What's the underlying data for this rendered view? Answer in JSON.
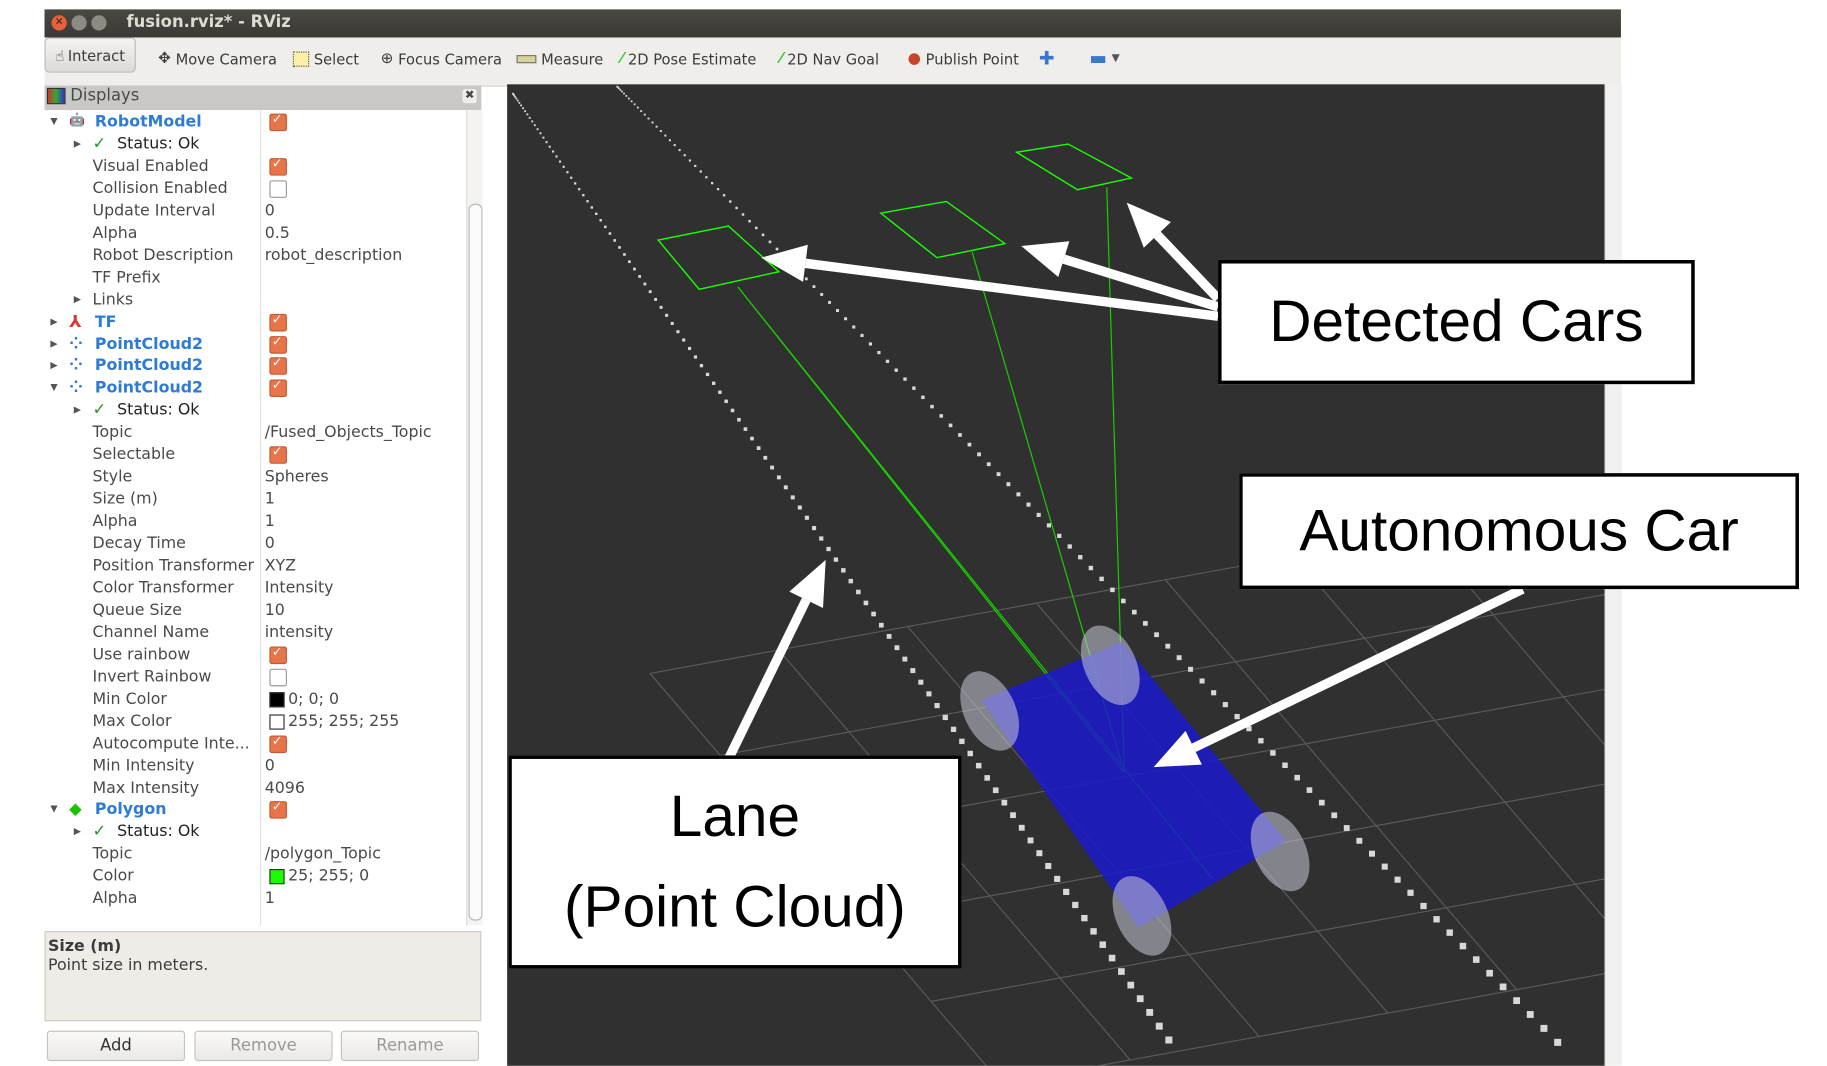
{
  "window": {
    "title": "fusion.rviz* - RViz"
  },
  "toolbar": {
    "items": [
      {
        "icon": "hand-pointer-icon",
        "label": "Interact",
        "pressed": true
      },
      {
        "icon": "move-camera-icon",
        "label": "Move Camera"
      },
      {
        "icon": "select-box-icon",
        "label": "Select"
      },
      {
        "icon": "focus-camera-icon",
        "label": "Focus Camera"
      },
      {
        "icon": "ruler-icon",
        "label": "Measure"
      },
      {
        "icon": "green-arrow-icon",
        "label": "2D Pose Estimate"
      },
      {
        "icon": "green-arrow-icon",
        "label": "2D Nav Goal"
      },
      {
        "icon": "map-pin-icon",
        "label": "Publish Point"
      }
    ],
    "add_tool_icon": "plus-icon",
    "remove_tool_icon": "minus-icon"
  },
  "displays": {
    "title": "Displays",
    "rows": [
      {
        "lvl": 0,
        "exp": "down",
        "icon": "robot",
        "label": "RobotModel",
        "check": true
      },
      {
        "lvl": 1,
        "exp": "right",
        "icon": "ok",
        "label": "Status: Ok"
      },
      {
        "lvl": 1,
        "label": "Visual Enabled",
        "check": true
      },
      {
        "lvl": 1,
        "label": "Collision Enabled",
        "check": false
      },
      {
        "lvl": 1,
        "label": "Update Interval",
        "value": "0"
      },
      {
        "lvl": 1,
        "label": "Alpha",
        "value": "0.5"
      },
      {
        "lvl": 1,
        "label": "Robot Description",
        "value": "robot_description"
      },
      {
        "lvl": 1,
        "label": "TF Prefix"
      },
      {
        "lvl": 1,
        "exp": "right",
        "label": "Links"
      },
      {
        "lvl": 0,
        "exp": "right",
        "icon": "tf",
        "label": "TF",
        "check": true
      },
      {
        "lvl": 0,
        "exp": "right",
        "icon": "cloud",
        "label": "PointCloud2",
        "check": true
      },
      {
        "lvl": 0,
        "exp": "right",
        "icon": "cloud",
        "label": "PointCloud2",
        "check": true
      },
      {
        "lvl": 0,
        "exp": "down",
        "icon": "cloud",
        "label": "PointCloud2",
        "check": true
      },
      {
        "lvl": 1,
        "exp": "right",
        "icon": "ok",
        "label": "Status: Ok"
      },
      {
        "lvl": 1,
        "label": "Topic",
        "value": "/Fused_Objects_Topic"
      },
      {
        "lvl": 1,
        "label": "Selectable",
        "check": true
      },
      {
        "lvl": 1,
        "label": "Style",
        "value": "Spheres"
      },
      {
        "lvl": 1,
        "label": "Size (m)",
        "value": "1"
      },
      {
        "lvl": 1,
        "label": "Alpha",
        "value": "1"
      },
      {
        "lvl": 1,
        "label": "Decay Time",
        "value": "0"
      },
      {
        "lvl": 1,
        "label": "Position Transformer",
        "value": "XYZ"
      },
      {
        "lvl": 1,
        "label": "Color Transformer",
        "value": "Intensity"
      },
      {
        "lvl": 1,
        "label": "Queue Size",
        "value": "10"
      },
      {
        "lvl": 1,
        "label": "Channel Name",
        "value": "intensity"
      },
      {
        "lvl": 1,
        "label": "Use rainbow",
        "check": true
      },
      {
        "lvl": 1,
        "label": "Invert Rainbow",
        "check": false
      },
      {
        "lvl": 1,
        "label": "Min Color",
        "value": "0; 0; 0",
        "swatch": "#000000"
      },
      {
        "lvl": 1,
        "label": "Max Color",
        "value": "255; 255; 255",
        "swatch": "#ffffff"
      },
      {
        "lvl": 1,
        "label": "Autocompute Inte...",
        "check": true
      },
      {
        "lvl": 1,
        "label": "Min Intensity",
        "value": "0"
      },
      {
        "lvl": 1,
        "label": "Max Intensity",
        "value": "4096"
      },
      {
        "lvl": 0,
        "exp": "down",
        "icon": "polygon",
        "label": "Polygon",
        "check": true
      },
      {
        "lvl": 1,
        "exp": "right",
        "icon": "ok",
        "label": "Status: Ok"
      },
      {
        "lvl": 1,
        "label": "Topic",
        "value": "/polygon_Topic"
      },
      {
        "lvl": 1,
        "label": "Color",
        "value": "25; 255; 0",
        "swatch": "#19ff00"
      },
      {
        "lvl": 1,
        "label": "Alpha",
        "value": "1"
      }
    ]
  },
  "description": {
    "title": "Size (m)",
    "text": "Point size in meters."
  },
  "buttons": {
    "add": "Add",
    "remove": "Remove",
    "rename": "Rename"
  },
  "callouts": {
    "detected": "Detected Cars",
    "autonomous": "Autonomous Car",
    "lane_line1": "Lane",
    "lane_line2": "(Point Cloud)"
  },
  "colors": {
    "checkbox": "#e8754a",
    "display_name": "#2e7bd6",
    "car_body": "#1a1acc",
    "polygon": "#19ff00",
    "viewport_bg": "#303030"
  }
}
